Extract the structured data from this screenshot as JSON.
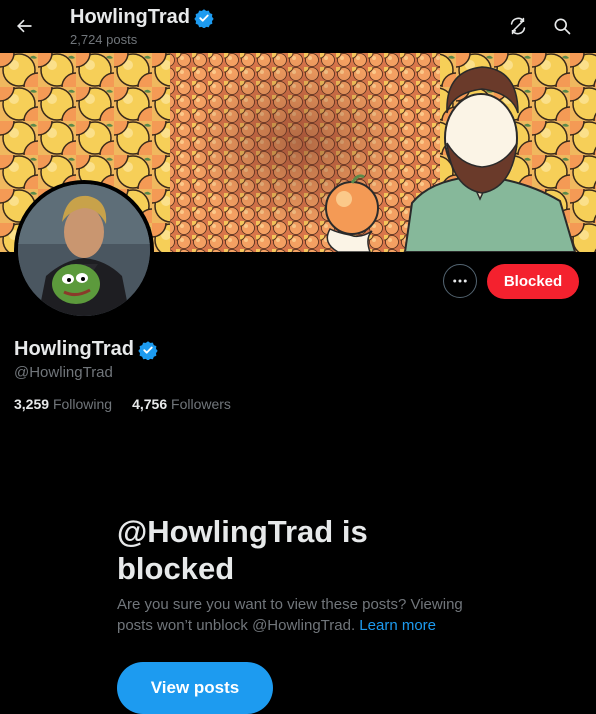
{
  "header": {
    "name": "HowlingTrad",
    "post_count": "2,724 posts",
    "back_icon": "arrow-left-icon",
    "icons": [
      "sync-icon",
      "search-icon"
    ]
  },
  "banner": {
    "description": "illustrated banner of many oranges and a man holding an orange"
  },
  "profile": {
    "display_name": "HowlingTrad",
    "handle": "@HowlingTrad",
    "following_count": "3,259",
    "following_label": "Following",
    "followers_count": "4,756",
    "followers_label": "Followers",
    "blocked_button": "Blocked"
  },
  "blocked_notice": {
    "title": "@HowlingTrad is blocked",
    "text": "Are you sure you want to view these posts? Viewing posts won’t unblock @HowlingTrad.",
    "link": "Learn more",
    "button": "View posts"
  },
  "colors": {
    "accent": "#1d9bf0",
    "blocked": "#f4212e",
    "muted": "#71767b"
  }
}
